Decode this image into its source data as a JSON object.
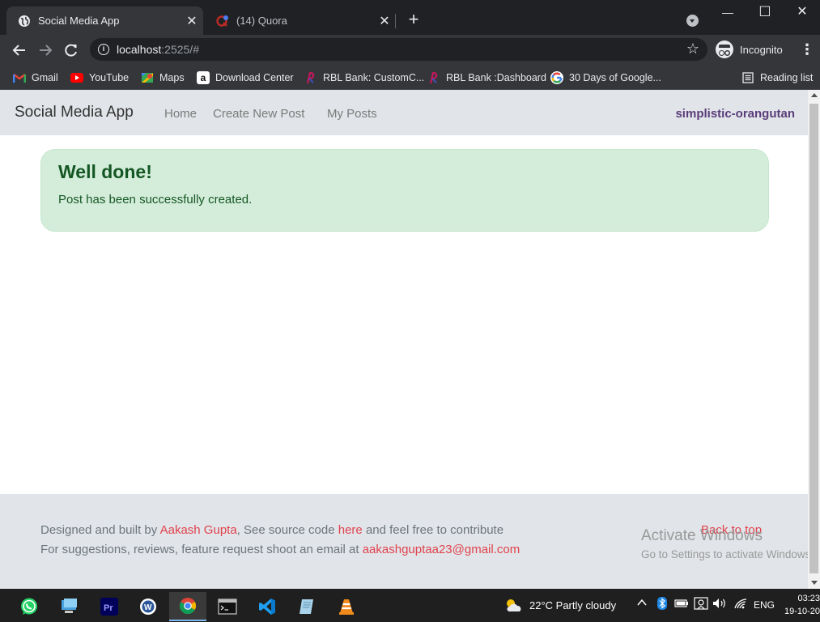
{
  "browser": {
    "tabs": [
      {
        "title": "Social Media App",
        "active": true
      },
      {
        "title": "(14) Quora",
        "active": false
      }
    ],
    "new_tab": "+",
    "window_controls": {
      "minimize": "—",
      "maximize": "☐",
      "close": "✕"
    },
    "url_host": "localhost",
    "url_rest": ":2525/#",
    "incognito_label": "Incognito",
    "bookmarks": [
      {
        "label": "Gmail",
        "icon": "gmail-icon"
      },
      {
        "label": "YouTube",
        "icon": "youtube-icon"
      },
      {
        "label": "Maps",
        "icon": "maps-icon"
      },
      {
        "label": "Download Center",
        "icon": "amazon-icon"
      },
      {
        "label": "RBL Bank: CustomC...",
        "icon": "rbl-icon"
      },
      {
        "label": "RBL Bank :Dashboard",
        "icon": "rbl-icon"
      },
      {
        "label": "30 Days of Google...",
        "icon": "google-icon"
      }
    ],
    "reading_list": "Reading list"
  },
  "app": {
    "brand": "Social Media App",
    "nav": [
      {
        "label": "Home"
      },
      {
        "label": "Create New Post"
      },
      {
        "label": "My Posts"
      }
    ],
    "username": "simplistic-orangutan",
    "alert": {
      "heading": "Well done!",
      "message": "Post has been successfully created."
    },
    "footer": {
      "line1_pre": "Designed and built by ",
      "author": "Aakash Gupta",
      "line1_mid": ", See source code ",
      "source_link": "here",
      "line1_post": " and feel free to contribute",
      "line2_pre": "For suggestions, reviews, feature request shoot an email at ",
      "email": "aakashguptaa23@gmail.com",
      "back_to_top": "Back to top"
    }
  },
  "watermark": {
    "line1": "Activate Windows",
    "line2": "Go to Settings to activate Windows."
  },
  "taskbar": {
    "weather": "22°C  Partly cloudy",
    "language": "ENG",
    "time": "03:23",
    "date": "19-10-20"
  },
  "colors": {
    "alert_bg": "#d4edda",
    "alert_text": "#155724",
    "link": "#e0434e",
    "username": "#5a3d7a",
    "navbar_bg": "#e1e4e8"
  }
}
